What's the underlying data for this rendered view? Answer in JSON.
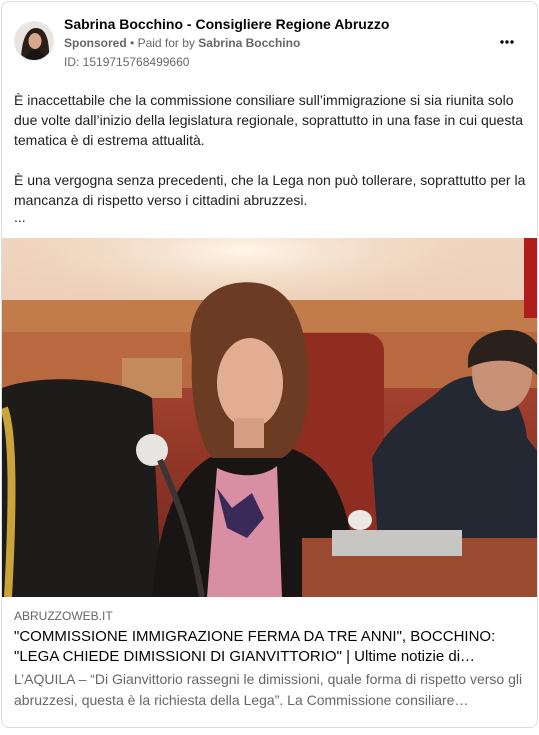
{
  "header": {
    "page_name": "Sabrina Bocchino - Consigliere Regione Abruzzo",
    "sponsored": "Sponsored",
    "separator": "•",
    "paid_for_by_prefix": "Paid for by",
    "paid_for_by_name": "Sabrina Bocchino",
    "ad_id": "ID: 1519715768499660",
    "more_icon": "more-horizontal-icon"
  },
  "post": {
    "paragraph_1": "È inaccettabile che la commissione consiliare sull’immigrazione si sia riunita solo due volte dall’inizio della legislatura regionale, soprattutto in una fase in cui questa tematica è di estrema attualità.",
    "paragraph_2": "È una vergogna senza precedenti, che la Lega non può tollerare, soprattutto per la mancanza di rispetto verso i cittadini abruzzesi.",
    "ellipsis": "..."
  },
  "link_preview": {
    "domain": "ABRUZZOWEB.IT",
    "headline": "\"COMMISSIONE IMMIGRAZIONE FERMA DA TRE ANNI\", BOCCHINO: \"LEGA CHIEDE DIMISSIONI DI GIANVITTORIO\" | Ultime notizie di…",
    "description": "L’AQUILA – “Di Gianvittorio rassegni le dimissioni, quale forma di rispetto verso gli abruzzesi, questa è la richiesta della Lega”. La Commissione consiliare…"
  },
  "colors": {
    "text_primary": "#050505",
    "text_secondary": "#65676b",
    "border": "#dadde1"
  }
}
